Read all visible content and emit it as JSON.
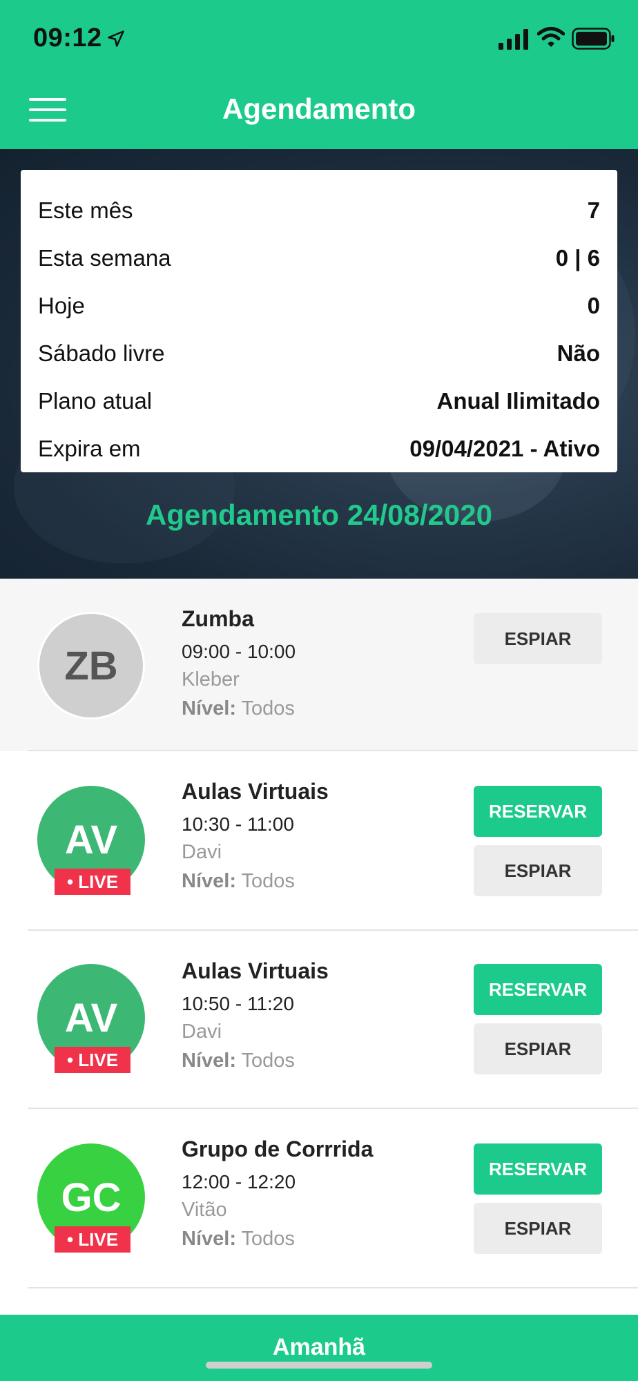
{
  "status_bar": {
    "time": "09:12"
  },
  "header": {
    "title": "Agendamento"
  },
  "summary": {
    "rows": [
      {
        "label": "Este mês",
        "value": "7"
      },
      {
        "label": "Esta semana",
        "value": "0 | 6"
      },
      {
        "label": "Hoje",
        "value": "0"
      },
      {
        "label": "Sábado livre",
        "value": "Não"
      },
      {
        "label": "Plano atual",
        "value": "Anual Ilimitado"
      },
      {
        "label": "Expira em",
        "value": "09/04/2021 - Ativo"
      }
    ]
  },
  "schedule": {
    "title": "Agendamento 24/08/2020",
    "level_label": "Nível:",
    "classes": [
      {
        "initials": "ZB",
        "name": "Zumba",
        "time": "09:00 - 10:00",
        "instructor": "Kleber",
        "level": "Todos",
        "live": "",
        "reserve_label": "",
        "spy_label": "ESPIAR"
      },
      {
        "initials": "AV",
        "name": "Aulas Virtuais",
        "time": "10:30 - 11:00",
        "instructor": "Davi",
        "level": "Todos",
        "live": "• LIVE",
        "reserve_label": "RESERVAR",
        "spy_label": "ESPIAR"
      },
      {
        "initials": "AV",
        "name": "Aulas Virtuais",
        "time": "10:50 - 11:20",
        "instructor": "Davi",
        "level": "Todos",
        "live": "• LIVE",
        "reserve_label": "RESERVAR",
        "spy_label": "ESPIAR"
      },
      {
        "initials": "GC",
        "name": "Grupo de Corrrida",
        "time": "12:00 - 12:20",
        "instructor": "Vitão",
        "level": "Todos",
        "live": "• LIVE",
        "reserve_label": "RESERVAR",
        "spy_label": "ESPIAR"
      }
    ]
  },
  "footer": {
    "label": "Amanhã"
  },
  "colors": {
    "brand": "#1ccb8c",
    "live": "#f0324a",
    "schedule_title": "#22c98c"
  }
}
